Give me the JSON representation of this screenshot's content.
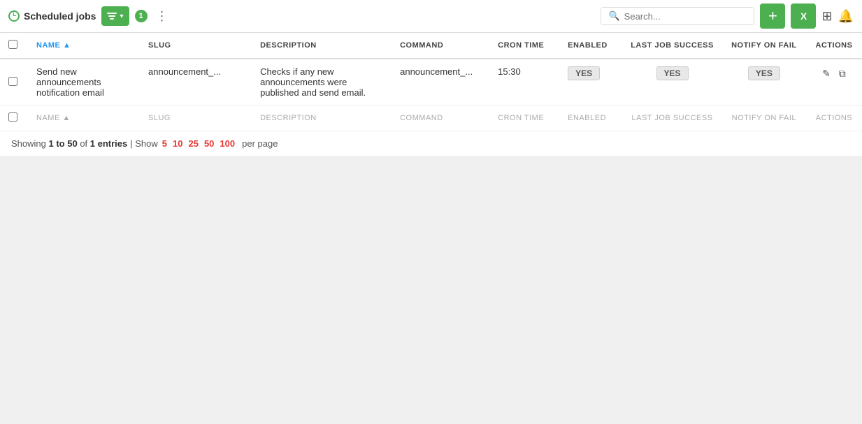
{
  "toolbar": {
    "title": "Scheduled jobs",
    "filter_label": "Filter",
    "badge_count": "1",
    "more_label": "⋮",
    "search_placeholder": "Search...",
    "add_label": "+",
    "excel_label": "X"
  },
  "table": {
    "columns": {
      "name": "NAME",
      "slug": "SLUG",
      "description": "DESCRIPTION",
      "command": "COMMAND",
      "cron_time": "CRON TIME",
      "enabled": "ENABLED",
      "last_job_success": "LAST JOB SUCCESS",
      "notify_on_fail": "NOTIFY ON FAIL",
      "actions": "ACTIONS"
    },
    "rows": [
      {
        "id": 1,
        "name": "Send new announcements notification email",
        "slug": "announcement_...",
        "description": "Checks if any new announcements were published and send email.",
        "command": "announcement_...",
        "cron_time": "15:30",
        "enabled": "YES",
        "last_job_success": "YES",
        "notify_on_fail": "YES"
      }
    ]
  },
  "pagination": {
    "showing_text": "Showing",
    "range": "1 to 50",
    "of_text": "of",
    "total": "1 entries",
    "show_label": "| Show",
    "options": [
      "5",
      "10",
      "25",
      "50",
      "100"
    ],
    "per_page_label": "per page"
  }
}
